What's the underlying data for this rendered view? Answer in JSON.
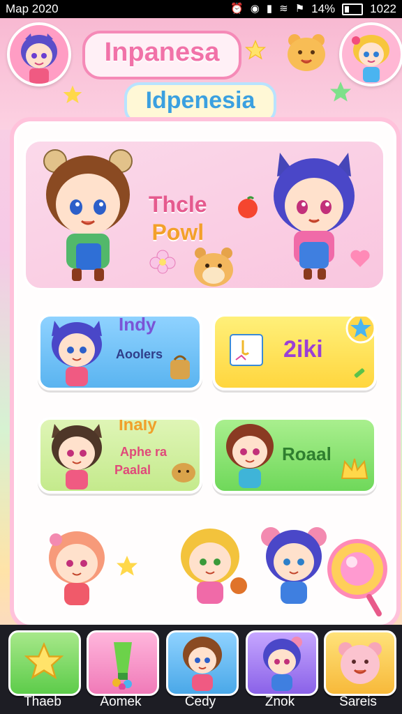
{
  "status_bar": {
    "left_text": "Map 2020",
    "battery": "14%",
    "time": "1022"
  },
  "header": {
    "title": "Inpanesa",
    "subtitle": "Idpenesia"
  },
  "banner": {
    "line1": "Thcle",
    "line2": "Powl"
  },
  "cards": [
    {
      "title": "Indy",
      "subtitle": "Aoolers"
    },
    {
      "title": "2iki"
    },
    {
      "title": "Inaly",
      "subtitle_line1": "Aphe ra",
      "subtitle_line2": "Paalal"
    },
    {
      "title": "Roaal"
    }
  ],
  "bottom_nav": [
    {
      "label": "Thaeb",
      "icon": "star-icon"
    },
    {
      "label": "Aomek",
      "icon": "paint-tube-icon"
    },
    {
      "label": "Cedy",
      "icon": "boy-avatar-icon"
    },
    {
      "label": "Znok",
      "icon": "girl-avatar-icon"
    },
    {
      "label": "Sareis",
      "icon": "bear-face-icon"
    }
  ],
  "colors": {
    "accent_pink": "#f172a8",
    "accent_blue": "#3aa0e0",
    "nav_bg": "#1d1d24"
  }
}
